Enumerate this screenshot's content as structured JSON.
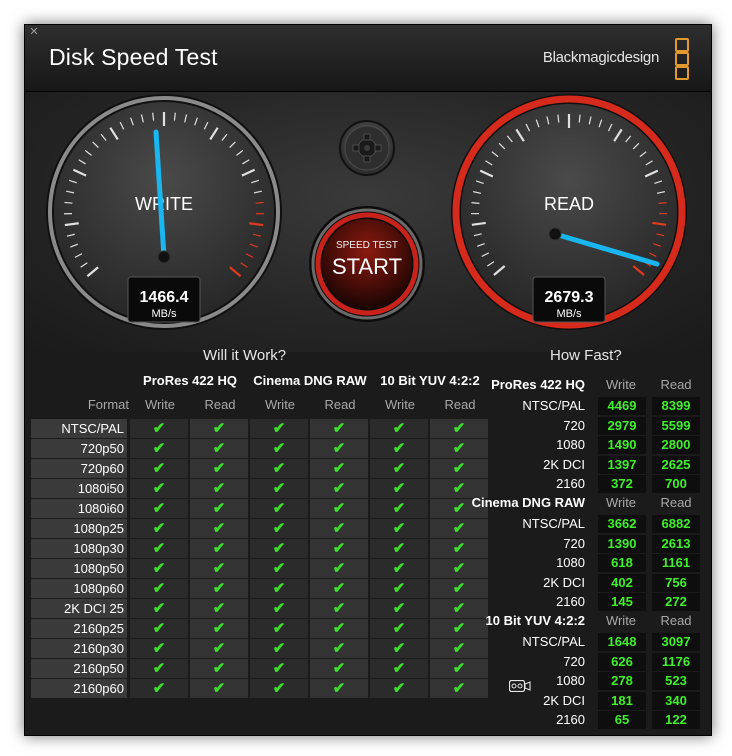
{
  "window": {
    "title": "Disk Speed Test",
    "brand": "Blackmagicdesign",
    "close_icon": "close-icon"
  },
  "gauges": {
    "write": {
      "label": "WRITE",
      "value": "1466.4",
      "unit": "MB/s"
    },
    "read": {
      "label": "READ",
      "value": "2679.3",
      "unit": "MB/s"
    }
  },
  "start_button": {
    "top_label": "SPEED TEST",
    "main_label": "START"
  },
  "colors": {
    "needle": "#19b6f0",
    "check": "#3edc2c",
    "value_green": "#3ff02b",
    "read_ring": "#d52a1c",
    "redline": "#e03a1c"
  },
  "will_it_work": {
    "title": "Will it Work?",
    "format_header": "Format",
    "groups": [
      {
        "name": "ProRes 422 HQ",
        "write": "Write",
        "read": "Read"
      },
      {
        "name": "Cinema DNG RAW",
        "write": "Write",
        "read": "Read"
      },
      {
        "name": "10 Bit YUV 4:2:2",
        "write": "Write",
        "read": "Read"
      }
    ],
    "rows": [
      {
        "format": "NTSC/PAL",
        "checks": [
          true,
          true,
          true,
          true,
          true,
          true
        ]
      },
      {
        "format": "720p50",
        "checks": [
          true,
          true,
          true,
          true,
          true,
          true
        ]
      },
      {
        "format": "720p60",
        "checks": [
          true,
          true,
          true,
          true,
          true,
          true
        ]
      },
      {
        "format": "1080i50",
        "checks": [
          true,
          true,
          true,
          true,
          true,
          true
        ]
      },
      {
        "format": "1080i60",
        "checks": [
          true,
          true,
          true,
          true,
          true,
          true
        ]
      },
      {
        "format": "1080p25",
        "checks": [
          true,
          true,
          true,
          true,
          true,
          true
        ]
      },
      {
        "format": "1080p30",
        "checks": [
          true,
          true,
          true,
          true,
          true,
          true
        ]
      },
      {
        "format": "1080p50",
        "checks": [
          true,
          true,
          true,
          true,
          true,
          true
        ]
      },
      {
        "format": "1080p60",
        "checks": [
          true,
          true,
          true,
          true,
          true,
          true
        ]
      },
      {
        "format": "2K DCI 25",
        "checks": [
          true,
          true,
          true,
          true,
          true,
          true
        ]
      },
      {
        "format": "2160p25",
        "checks": [
          true,
          true,
          true,
          true,
          true,
          true
        ]
      },
      {
        "format": "2160p30",
        "checks": [
          true,
          true,
          true,
          true,
          true,
          true
        ]
      },
      {
        "format": "2160p50",
        "checks": [
          true,
          true,
          true,
          true,
          true,
          true
        ]
      },
      {
        "format": "2160p60",
        "checks": [
          true,
          true,
          true,
          true,
          true,
          true
        ]
      }
    ]
  },
  "how_fast": {
    "title": "How Fast?",
    "sections": [
      {
        "name": "ProRes 422 HQ",
        "write_header": "Write",
        "read_header": "Read",
        "rows": [
          {
            "format": "NTSC/PAL",
            "write": "4469",
            "read": "8399"
          },
          {
            "format": "720",
            "write": "2979",
            "read": "5599"
          },
          {
            "format": "1080",
            "write": "1490",
            "read": "2800"
          },
          {
            "format": "2K DCI",
            "write": "1397",
            "read": "2625"
          },
          {
            "format": "2160",
            "write": "372",
            "read": "700"
          }
        ]
      },
      {
        "name": "Cinema DNG RAW",
        "write_header": "Write",
        "read_header": "Read",
        "rows": [
          {
            "format": "NTSC/PAL",
            "write": "3662",
            "read": "6882"
          },
          {
            "format": "720",
            "write": "1390",
            "read": "2613"
          },
          {
            "format": "1080",
            "write": "618",
            "read": "1161"
          },
          {
            "format": "2K DCI",
            "write": "402",
            "read": "756"
          },
          {
            "format": "2160",
            "write": "145",
            "read": "272"
          }
        ]
      },
      {
        "name": "10 Bit YUV 4:2:2",
        "write_header": "Write",
        "read_header": "Read",
        "rows": [
          {
            "format": "NTSC/PAL",
            "write": "1648",
            "read": "3097"
          },
          {
            "format": "720",
            "write": "626",
            "read": "1176"
          },
          {
            "format": "1080",
            "write": "278",
            "read": "523"
          },
          {
            "format": "2K DCI",
            "write": "181",
            "read": "340"
          },
          {
            "format": "2160",
            "write": "65",
            "read": "122"
          }
        ]
      }
    ],
    "aux_icon": "video-camera-icon"
  },
  "icons": {
    "settings": "gear-icon",
    "check": "checkmark-icon"
  }
}
